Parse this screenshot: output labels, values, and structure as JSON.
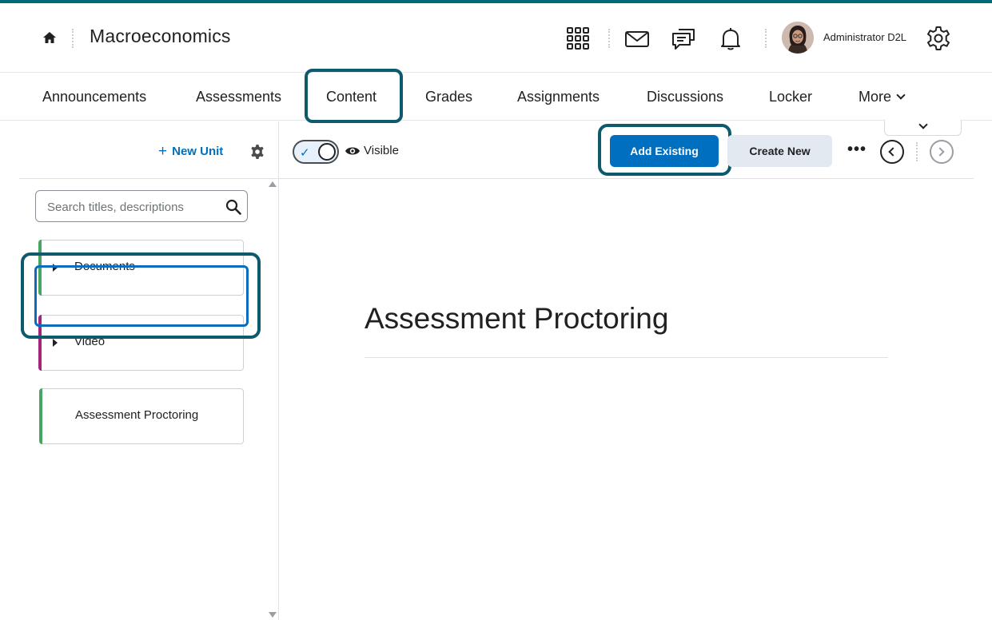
{
  "header": {
    "course_title": "Macroeconomics",
    "user_name": "Administrator D2L",
    "icons": [
      "home-icon",
      "apps-grid-icon",
      "mail-icon",
      "chat-icon",
      "bell-icon",
      "gear-icon"
    ]
  },
  "nav": {
    "items": [
      {
        "label": "Announcements"
      },
      {
        "label": "Assessments"
      },
      {
        "label": "Content"
      },
      {
        "label": "Grades"
      },
      {
        "label": "Assignments"
      },
      {
        "label": "Discussions"
      },
      {
        "label": "Locker"
      },
      {
        "label": "More"
      }
    ],
    "active": "Content"
  },
  "sidebar": {
    "new_unit_label": "New Unit",
    "search_placeholder": "Search titles, descriptions",
    "units": [
      {
        "label": "Documents",
        "accent": "#46a661"
      },
      {
        "label": "Video",
        "accent": "#a4237b"
      },
      {
        "label": "Assessment Proctoring",
        "accent": "#46a661"
      }
    ]
  },
  "toolbar": {
    "visible_label": "Visible",
    "add_existing_label": "Add Existing",
    "create_new_label": "Create New",
    "more_label": "•••"
  },
  "main": {
    "title": "Assessment Proctoring"
  },
  "colors": {
    "accent_blue": "#006fbf",
    "highlight": "#0e5a6c",
    "top_bar": "#006a78"
  }
}
